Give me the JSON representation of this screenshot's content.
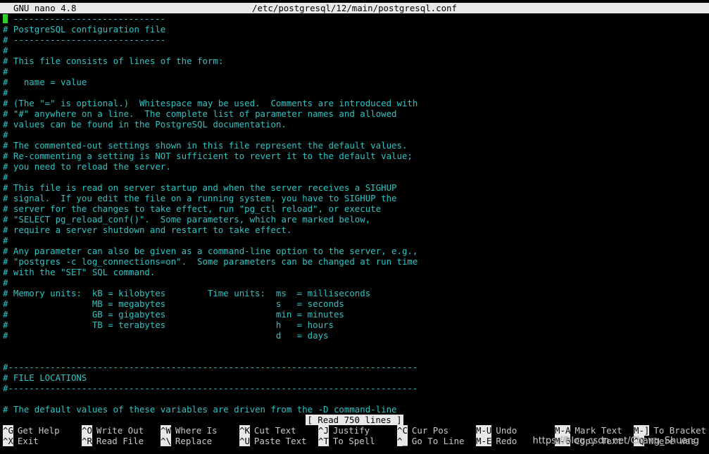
{
  "title": {
    "app": "GNU nano 4.8",
    "file": "/etc/postgresql/12/main/postgresql.conf"
  },
  "lines": [
    "# -----------------------------",
    "# PostgreSQL configuration file",
    "# -----------------------------",
    "#",
    "# This file consists of lines of the form:",
    "#",
    "#   name = value",
    "#",
    "# (The \"=\" is optional.)  Whitespace may be used.  Comments are introduced with",
    "# \"#\" anywhere on a line.  The complete list of parameter names and allowed",
    "# values can be found in the PostgreSQL documentation.",
    "#",
    "# The commented-out settings shown in this file represent the default values.",
    "# Re-commenting a setting is NOT sufficient to revert it to the default value;",
    "# you need to reload the server.",
    "#",
    "# This file is read on server startup and when the server receives a SIGHUP",
    "# signal.  If you edit the file on a running system, you have to SIGHUP the",
    "# server for the changes to take effect, run \"pg_ctl reload\", or execute",
    "# \"SELECT pg_reload_conf()\".  Some parameters, which are marked below,",
    "# require a server shutdown and restart to take effect.",
    "#",
    "# Any parameter can also be given as a command-line option to the server, e.g.,",
    "# \"postgres -c log_connections=on\".  Some parameters can be changed at run time",
    "# with the \"SET\" SQL command.",
    "#",
    "# Memory units:  kB = kilobytes        Time units:  ms  = milliseconds",
    "#                MB = megabytes                     s   = seconds",
    "#                GB = gigabytes                     min = minutes",
    "#                TB = terabytes                     h   = hours",
    "#                                                   d   = days",
    "",
    "",
    "#------------------------------------------------------------------------------",
    "# FILE LOCATIONS",
    "#------------------------------------------------------------------------------",
    "",
    "# The default values of these variables are driven from the -D command-line"
  ],
  "status": "[ Read 750 lines ]",
  "shortcuts": [
    {
      "key": "^G",
      "label": "Get Help"
    },
    {
      "key": "^X",
      "label": "Exit"
    },
    {
      "key": "^O",
      "label": "Write Out"
    },
    {
      "key": "^R",
      "label": "Read File"
    },
    {
      "key": "^W",
      "label": "Where Is"
    },
    {
      "key": "^\\",
      "label": "Replace"
    },
    {
      "key": "^K",
      "label": "Cut Text"
    },
    {
      "key": "^U",
      "label": "Paste Text"
    },
    {
      "key": "^J",
      "label": "Justify"
    },
    {
      "key": "^T",
      "label": "To Spell"
    },
    {
      "key": "^C",
      "label": "Cur Pos"
    },
    {
      "key": "^_",
      "label": "Go To Line"
    },
    {
      "key": "M-U",
      "label": "Undo"
    },
    {
      "key": "M-E",
      "label": "Redo"
    },
    {
      "key": "M-A",
      "label": "Mark Text"
    },
    {
      "key": "M-6",
      "label": "Copy Text"
    },
    {
      "key": "M-]",
      "label": "To Bracket"
    },
    {
      "key": "^Q",
      "label": "Where Was"
    }
  ],
  "watermark": "https://blog.csdn.net/Chang_Shuang",
  "colors": {
    "text": "#2ec4c4",
    "cursor": "#2fcf2f",
    "bar": "#e8e8e8"
  }
}
